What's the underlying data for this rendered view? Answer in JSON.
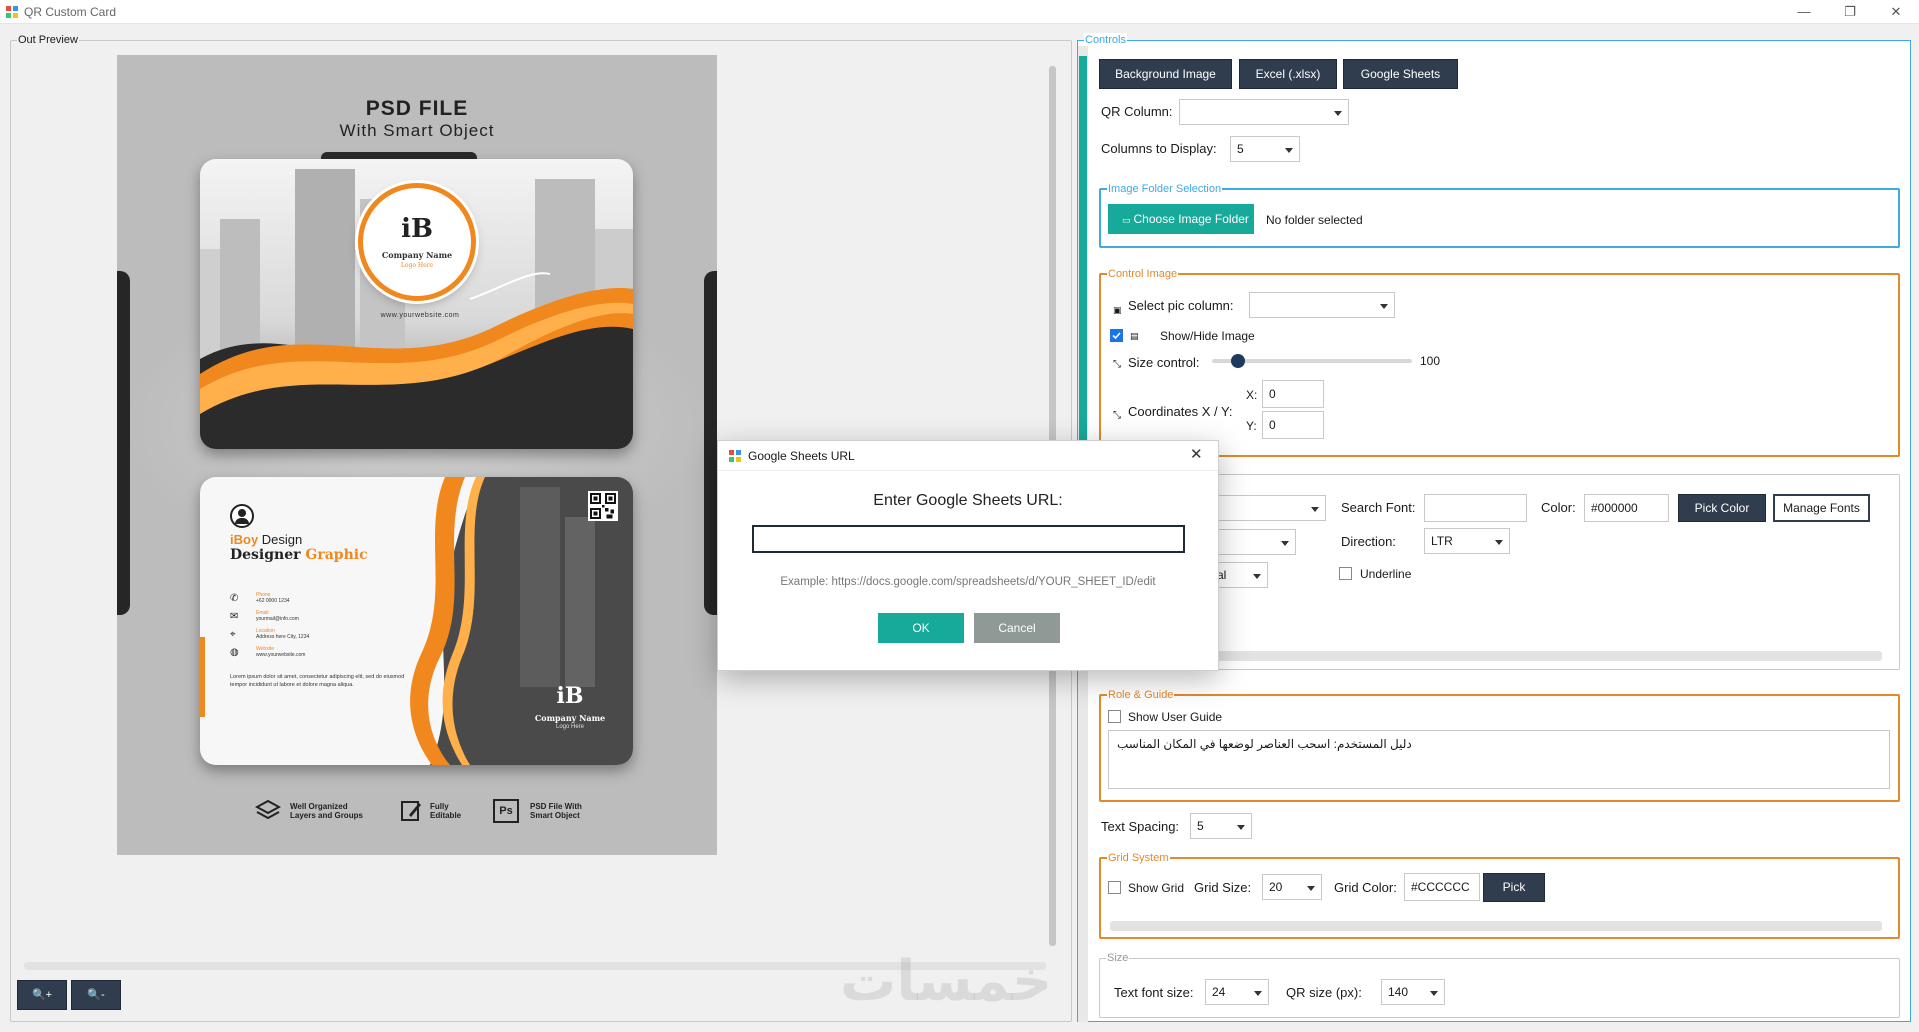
{
  "window": {
    "title": "QR Custom Card",
    "controls": [
      "—",
      "❐",
      "✕"
    ]
  },
  "preview": {
    "group_title": "Out Preview",
    "zoom_in_label": "🔍+",
    "zoom_out_label": "🔍-",
    "card": {
      "title": "PSD FILE",
      "subtitle": "With Smart Object",
      "front": {
        "logo": "iB",
        "company": "Company Name",
        "tagline": "Logo Here",
        "website": "www.yourwebsite.com"
      },
      "back": {
        "brand_a": "iBoy",
        "brand_b": " Design",
        "role_a": "Designer ",
        "role_b": "Graphic",
        "contacts": [
          {
            "icon": "phone-icon",
            "label": "Phone",
            "value": "+62 0000 1234"
          },
          {
            "icon": "mail-icon",
            "label": "Email",
            "value": "yourmail@info.com"
          },
          {
            "icon": "location-icon",
            "label": "Location",
            "value": "Address here City, 1234"
          },
          {
            "icon": "globe-icon",
            "label": "Website",
            "value": "www.yourwebsite.com"
          }
        ],
        "lorem": "Lorem ipsum dolor sit amet, consectetur adipiscing elit, sed do eiusmod tempor incididunt ut labore et dolore magna aliqua.",
        "logo": "iB",
        "company": "Company Name",
        "tagline": "Logo Here"
      },
      "features": [
        {
          "icon": "layers-icon",
          "line1": "Well Organized",
          "line2": "Layers and Groups"
        },
        {
          "icon": "edit-icon",
          "line1": "Fully",
          "line2": "Editable"
        },
        {
          "icon": "ps-icon",
          "glyph": "Ps",
          "line1": "PSD File With",
          "line2": "Smart Object"
        }
      ]
    }
  },
  "controls": {
    "group_title": "Controls",
    "buttons": {
      "background": "Background Image",
      "excel": "Excel (.xlsx)",
      "sheets": "Google Sheets"
    },
    "qr_column_label": "QR Column:",
    "qr_column_value": "",
    "columns_label": "Columns to Display:",
    "columns_value": "5",
    "folder": {
      "title": "Image Folder Selection",
      "button": "Choose Image Folder",
      "status": "No folder selected"
    },
    "image": {
      "title": "Control Image",
      "pic_col_label": "Select pic column:",
      "pic_col_value": "",
      "show_hide": "Show/Hide Image",
      "show_hide_checked": true,
      "size_label": "Size control:",
      "size_value": "100",
      "size_fraction": 0.1,
      "coords_label": "Coordinates X / Y:",
      "x_label": "X:",
      "y_label": "Y:",
      "x_value": "0",
      "y_value": "0"
    },
    "font": {
      "font_value": "",
      "search_label": "Search Font:",
      "search_value": "",
      "color_label": "Color:",
      "color_value": "#000000",
      "pick_color": "Pick Color",
      "manage_fonts": "Manage Fonts",
      "style_value": "",
      "direction_label": "Direction:",
      "direction_value": "LTR",
      "third_value": "al",
      "underline_label": "Underline"
    },
    "guide": {
      "title": "Role & Guide",
      "show_label": "Show User Guide",
      "text": "دليل المستخدم: اسحب العناصر لوضعها في المكان المناسب"
    },
    "spacing_label": "Text Spacing:",
    "spacing_value": "5",
    "grid": {
      "title": "Grid System",
      "show_label": "Show Grid",
      "size_label": "Grid Size:",
      "size_value": "20",
      "color_label": "Grid Color:",
      "color_value": "#CCCCCC",
      "pick": "Pick"
    },
    "size": {
      "title": "Size",
      "font_label": "Text font size:",
      "font_value": "24",
      "qr_label": "QR size (px):",
      "qr_value": "140"
    }
  },
  "dialog": {
    "title": "Google Sheets URL",
    "prompt": "Enter Google Sheets URL:",
    "url_value": "",
    "example": "Example: https://docs.google.com/spreadsheets/d/YOUR_SHEET_ID/edit",
    "ok": "OK",
    "cancel": "Cancel"
  },
  "watermark": "خمسات",
  "colors": {
    "accent": "#17a99a",
    "dark_button": "#2f3d4e",
    "orange": "#f0881e",
    "brand_blue": "#3fa9e3"
  }
}
